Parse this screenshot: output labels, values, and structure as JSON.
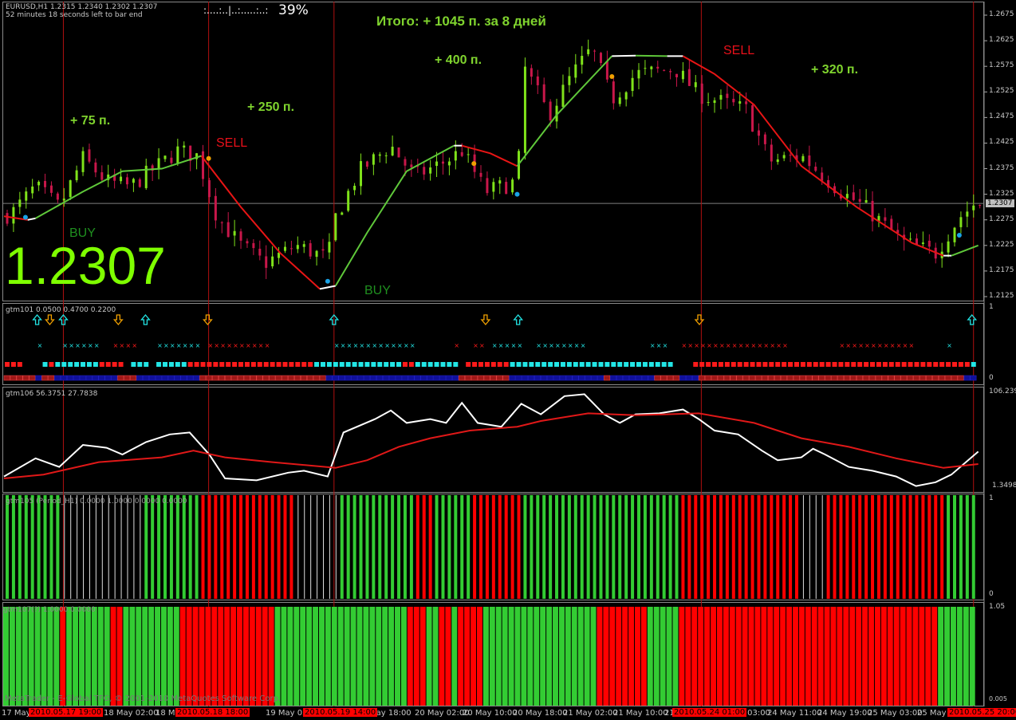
{
  "header": {
    "symbol_line": "EURUSD,H1  1.2315 1.2340 1.2302 1.2307",
    "timer_line": "52 minutes 18 seconds left to bar end",
    "progress_dots": ":....:..|..:.....:..:",
    "progress_percent": "39%"
  },
  "big_price": "1.2307",
  "annotations": {
    "total": "Итого: + 1045 п. за 8 дней",
    "p75": "+ 75 п.",
    "p250": "+ 250 п.",
    "p400": "+ 400 п.",
    "p320": "+ 320 п.",
    "sell1": "SELL",
    "sell2": "SELL",
    "buy1": "BUY",
    "buy2": "BUY"
  },
  "price_axis": {
    "ticks": [
      "1.2675",
      "1.2625",
      "1.2575",
      "1.2525",
      "1.2475",
      "1.2425",
      "1.2375",
      "1.2325",
      "1.2275",
      "1.2225",
      "1.2175",
      "1.2125"
    ],
    "current": "1.2307"
  },
  "indicators": {
    "gtm101": {
      "label": "gtm101 0.0500 0.4700 0.2200",
      "max": "1",
      "min": "0"
    },
    "gtm106": {
      "label": "gtm106 56.3751 27.7838",
      "max": "106.2393",
      "min": "1.3498"
    },
    "gtm105": {
      "label": "gtm105 (Period_H1) 0.0000 1.0000 0.0000 0.0000",
      "max": "1",
      "min": "0"
    },
    "gtm107": {
      "label": "gtm107(?) 1.0000 0.0000",
      "max": "1.05",
      "min": "0.005"
    }
  },
  "time_axis": {
    "labels": [
      "17 May",
      "18 May 02:00",
      "18 Ma",
      "19 May 02:00",
      "May 18:00",
      "20 May 02:00",
      "20 May 10:00",
      "20 May 18:00",
      "21 May 02:00",
      "21 May 10:00",
      "21",
      "y 03:00",
      "24 May 11:00",
      "24 May 19:00",
      "25 May 03:00",
      "25 May"
    ],
    "markers": [
      "2010.05.17 19:00",
      "2010.05.18 18:00",
      "2010.05.19 14:00",
      "2010.05.24 01:00",
      "2010.05.25 20:00"
    ]
  },
  "footer": "MetaTrader - E-Global TFG, © 2001-2010 MetaQuotes Software Corp.",
  "colors": {
    "up": "#7fe21a",
    "down": "#c8174a",
    "ma_green": "#5fc83a",
    "ma_red": "#e81515",
    "cyan": "#22e5e5",
    "orange": "#f0a000",
    "blue_dot": "#1aa3e6",
    "bar_green": "#33cc33",
    "bar_red": "#ff0000"
  },
  "chart_data": {
    "type": "candlestick",
    "symbol": "EURUSD",
    "timeframe": "H1",
    "ylim": [
      1.2125,
      1.2675
    ],
    "x_unit": "bar",
    "close_path": [
      [
        1,
        1.2285
      ],
      [
        5,
        1.234
      ],
      [
        8.75,
        1.23
      ],
      [
        12.5,
        1.2395
      ],
      [
        16.25,
        1.235
      ],
      [
        20,
        1.234
      ],
      [
        27.5,
        1.241
      ],
      [
        30.6,
        1.24
      ],
      [
        33.75,
        1.228
      ],
      [
        37.5,
        1.2225
      ],
      [
        41.25,
        1.219
      ],
      [
        46.25,
        1.2225
      ],
      [
        51.25,
        1.22
      ],
      [
        52.5,
        1.228
      ],
      [
        56.25,
        1.237
      ],
      [
        61.25,
        1.242
      ],
      [
        65,
        1.236
      ],
      [
        70,
        1.239
      ],
      [
        72.5,
        1.241
      ],
      [
        76.25,
        1.233
      ],
      [
        81.25,
        1.235
      ],
      [
        82.5,
        1.257
      ],
      [
        86.25,
        1.248
      ],
      [
        90,
        1.256
      ],
      [
        93.1,
        1.261
      ],
      [
        96.25,
        1.251
      ],
      [
        100,
        1.256
      ],
      [
        106.25,
        1.257
      ],
      [
        110,
        1.252
      ],
      [
        115,
        1.25
      ],
      [
        117.5,
        1.249
      ],
      [
        121.25,
        1.239
      ],
      [
        126.25,
        1.24
      ],
      [
        132.5,
        1.233
      ],
      [
        136.25,
        1.23
      ],
      [
        142.5,
        1.223
      ],
      [
        147.5,
        1.221
      ],
      [
        151.25,
        1.228
      ],
      [
        153.75,
        1.2307
      ]
    ],
    "ma_segments": [
      {
        "color": "red",
        "points": [
          [
            0,
            1.2282
          ],
          [
            3.75,
            1.2275
          ]
        ]
      },
      {
        "color": "white",
        "points": [
          [
            3.75,
            1.2275
          ],
          [
            5,
            1.2278
          ]
        ]
      },
      {
        "color": "green",
        "points": [
          [
            5,
            1.2278
          ],
          [
            12.5,
            1.233
          ],
          [
            18.75,
            1.237
          ],
          [
            25,
            1.2375
          ],
          [
            31.25,
            1.24
          ]
        ]
      },
      {
        "color": "red",
        "points": [
          [
            31.25,
            1.24
          ],
          [
            37.5,
            1.23
          ],
          [
            43.75,
            1.221
          ],
          [
            50,
            1.214
          ]
        ]
      },
      {
        "color": "white",
        "points": [
          [
            50,
            1.214
          ],
          [
            52.5,
            1.2146
          ]
        ]
      },
      {
        "color": "green",
        "points": [
          [
            52.5,
            1.2146
          ],
          [
            57.5,
            1.225
          ],
          [
            63.75,
            1.237
          ],
          [
            71.25,
            1.242
          ]
        ]
      },
      {
        "color": "white",
        "points": [
          [
            71.25,
            1.242
          ],
          [
            72.5,
            1.242
          ]
        ]
      },
      {
        "color": "red",
        "points": [
          [
            72.5,
            1.242
          ],
          [
            77,
            1.2405
          ],
          [
            81.25,
            1.238
          ]
        ]
      },
      {
        "color": "green",
        "points": [
          [
            81.25,
            1.238
          ],
          [
            87.5,
            1.248
          ],
          [
            96.25,
            1.2595
          ]
        ]
      },
      {
        "color": "white",
        "points": [
          [
            96.25,
            1.2595
          ],
          [
            100,
            1.2596
          ]
        ]
      },
      {
        "color": "green",
        "points": [
          [
            100,
            1.2596
          ],
          [
            105,
            1.2595
          ]
        ]
      },
      {
        "color": "white",
        "points": [
          [
            105,
            1.2595
          ],
          [
            107.5,
            1.2595
          ]
        ]
      },
      {
        "color": "red",
        "points": [
          [
            107.5,
            1.2595
          ],
          [
            112.5,
            1.256
          ],
          [
            118.75,
            1.25
          ],
          [
            126.25,
            1.238
          ],
          [
            135,
            1.23
          ],
          [
            143.75,
            1.223
          ],
          [
            148.75,
            1.2205
          ]
        ]
      },
      {
        "color": "white",
        "points": [
          [
            148.75,
            1.2205
          ],
          [
            150,
            1.2205
          ]
        ]
      },
      {
        "color": "green",
        "points": [
          [
            150,
            1.2205
          ],
          [
            154.25,
            1.2225
          ]
        ]
      }
    ],
    "signal_dots": [
      {
        "color": "blue",
        "bar": 3.4,
        "price": 1.228
      },
      {
        "color": "blue",
        "bar": 51.25,
        "price": 1.2155
      },
      {
        "color": "blue",
        "bar": 81.25,
        "price": 1.2325
      },
      {
        "color": "blue",
        "bar": 151.25,
        "price": 1.2245
      },
      {
        "color": "orange",
        "bar": 32.4,
        "price": 1.2395
      },
      {
        "color": "orange",
        "bar": 74.4,
        "price": 1.2385
      },
      {
        "color": "orange",
        "bar": 96.25,
        "price": 1.2555
      }
    ],
    "signal_lines_bars": [
      9.4,
      32.4,
      52.25,
      110.4,
      153.5
    ],
    "gtm101": {
      "arrows": [
        {
          "dir": "up",
          "bar": 5.25
        },
        {
          "dir": "down",
          "bar": 7.25
        },
        {
          "dir": "up",
          "bar": 9.4
        },
        {
          "dir": "down",
          "bar": 18.1
        },
        {
          "dir": "up",
          "bar": 22.4
        },
        {
          "dir": "down",
          "bar": 32.25
        },
        {
          "dir": "up",
          "bar": 52.25
        },
        {
          "dir": "down",
          "bar": 76.25
        },
        {
          "dir": "up",
          "bar": 81.4
        },
        {
          "dir": "down",
          "bar": 110.1
        },
        {
          "dir": "up",
          "bar": 153.25
        }
      ],
      "x_runs": [
        [
          "K",
          5
        ],
        [
          "C",
          1
        ],
        [
          "K",
          3
        ],
        [
          "C",
          6
        ],
        [
          "K",
          2
        ],
        [
          "R",
          4
        ],
        [
          "K",
          3
        ],
        [
          "C",
          7
        ],
        [
          "K",
          1
        ],
        [
          "R",
          10
        ],
        [
          "K",
          10
        ],
        [
          "C",
          13
        ],
        [
          "K",
          6
        ],
        [
          "R",
          1
        ],
        [
          "K",
          2
        ],
        [
          "R",
          2
        ],
        [
          "K",
          1
        ],
        [
          "C",
          5
        ],
        [
          "K",
          2
        ],
        [
          "C",
          8
        ],
        [
          "K",
          10
        ],
        [
          "C",
          3
        ],
        [
          "K",
          2
        ],
        [
          "R",
          17
        ],
        [
          "K",
          8
        ],
        [
          "R",
          12
        ],
        [
          "K",
          5
        ],
        [
          "C",
          1
        ]
      ],
      "square_runs": [
        [
          "R",
          3
        ],
        [
          "K",
          3
        ],
        [
          "C",
          1
        ],
        [
          "R",
          1
        ],
        [
          "C",
          7
        ],
        [
          "R",
          4
        ],
        [
          "K",
          1
        ],
        [
          "C",
          3
        ],
        [
          "K",
          1
        ],
        [
          "C",
          5
        ],
        [
          "R",
          20
        ],
        [
          "C",
          14
        ],
        [
          "R",
          2
        ],
        [
          "C",
          7
        ],
        [
          "K",
          1
        ],
        [
          "R",
          7
        ],
        [
          "C",
          26
        ],
        [
          "K",
          3
        ],
        [
          "R",
          44
        ],
        [
          "C",
          1
        ]
      ],
      "band_runs": [
        [
          "R",
          5
        ],
        [
          "B",
          1
        ],
        [
          "R",
          2
        ],
        [
          "B",
          10
        ],
        [
          "R",
          3
        ],
        [
          "B",
          10
        ],
        [
          "R",
          20
        ],
        [
          "B",
          21
        ],
        [
          "R",
          8
        ],
        [
          "B",
          15
        ],
        [
          "R",
          1
        ],
        [
          "B",
          7
        ],
        [
          "R",
          4
        ],
        [
          "B",
          3
        ],
        [
          "R",
          42
        ],
        [
          "B",
          2
        ]
      ]
    },
    "gtm106": {
      "range": [
        0,
        100
      ],
      "white": [
        [
          0,
          12
        ],
        [
          5,
          31
        ],
        [
          8.75,
          22
        ],
        [
          12.5,
          45
        ],
        [
          16.25,
          42
        ],
        [
          18.75,
          35
        ],
        [
          22.5,
          48
        ],
        [
          26.25,
          56
        ],
        [
          29.4,
          58
        ],
        [
          32.5,
          35
        ],
        [
          35,
          10
        ],
        [
          40,
          8
        ],
        [
          45,
          16
        ],
        [
          47.5,
          18
        ],
        [
          51.25,
          12
        ],
        [
          53.75,
          58
        ],
        [
          58.75,
          72
        ],
        [
          61.25,
          81
        ],
        [
          63.75,
          68
        ],
        [
          67.5,
          72
        ],
        [
          70,
          68
        ],
        [
          72.5,
          89
        ],
        [
          75,
          68
        ],
        [
          78.75,
          64
        ],
        [
          81.9,
          88
        ],
        [
          85,
          77
        ],
        [
          88.75,
          96
        ],
        [
          91.9,
          98
        ],
        [
          95,
          77
        ],
        [
          97.5,
          68
        ],
        [
          100,
          77
        ],
        [
          103.75,
          78
        ],
        [
          107.5,
          82
        ],
        [
          110,
          72
        ],
        [
          112.5,
          60
        ],
        [
          116.25,
          56
        ],
        [
          120,
          39
        ],
        [
          122.5,
          29
        ],
        [
          126.25,
          32
        ],
        [
          128.1,
          41
        ],
        [
          130,
          35
        ],
        [
          133.75,
          22
        ],
        [
          137.5,
          18
        ],
        [
          141.25,
          12
        ],
        [
          144.4,
          2
        ],
        [
          147.5,
          6
        ],
        [
          150,
          14
        ],
        [
          154.25,
          38
        ]
      ],
      "red": [
        [
          0,
          10
        ],
        [
          6.25,
          14
        ],
        [
          15,
          27
        ],
        [
          25,
          32
        ],
        [
          30,
          39
        ],
        [
          35,
          32
        ],
        [
          42.5,
          27
        ],
        [
          52.5,
          21
        ],
        [
          57.5,
          29
        ],
        [
          62.5,
          43
        ],
        [
          67.5,
          52
        ],
        [
          73.75,
          60
        ],
        [
          81.25,
          64
        ],
        [
          85,
          70
        ],
        [
          92.5,
          78
        ],
        [
          100,
          76
        ],
        [
          110,
          78
        ],
        [
          118.75,
          68
        ],
        [
          126.25,
          52
        ],
        [
          133.75,
          43
        ],
        [
          141.25,
          31
        ],
        [
          148.75,
          21
        ],
        [
          154.25,
          25
        ]
      ]
    },
    "gtm105_runs": [
      [
        "G",
        9
      ],
      [
        "W",
        13
      ],
      [
        "G",
        9
      ],
      [
        "R",
        15
      ],
      [
        "W",
        7
      ],
      [
        "G",
        12
      ],
      [
        "R",
        3
      ],
      [
        "G",
        6
      ],
      [
        "R",
        8
      ],
      [
        "G",
        25
      ],
      [
        "R",
        19
      ],
      [
        "W",
        4
      ],
      [
        "R",
        19
      ],
      [
        "G",
        5
      ]
    ],
    "gtm107_runs": [
      [
        "G",
        9
      ],
      [
        "R",
        1
      ],
      [
        "G",
        7
      ],
      [
        "R",
        2
      ],
      [
        "G",
        9
      ],
      [
        "R",
        15
      ],
      [
        "G",
        21
      ],
      [
        "R",
        3
      ],
      [
        "G",
        2
      ],
      [
        "R",
        2
      ],
      [
        "G",
        1
      ],
      [
        "R",
        4
      ],
      [
        "G",
        18
      ],
      [
        "R",
        8
      ],
      [
        "G",
        5
      ],
      [
        "R",
        41
      ],
      [
        "G",
        6
      ]
    ]
  }
}
